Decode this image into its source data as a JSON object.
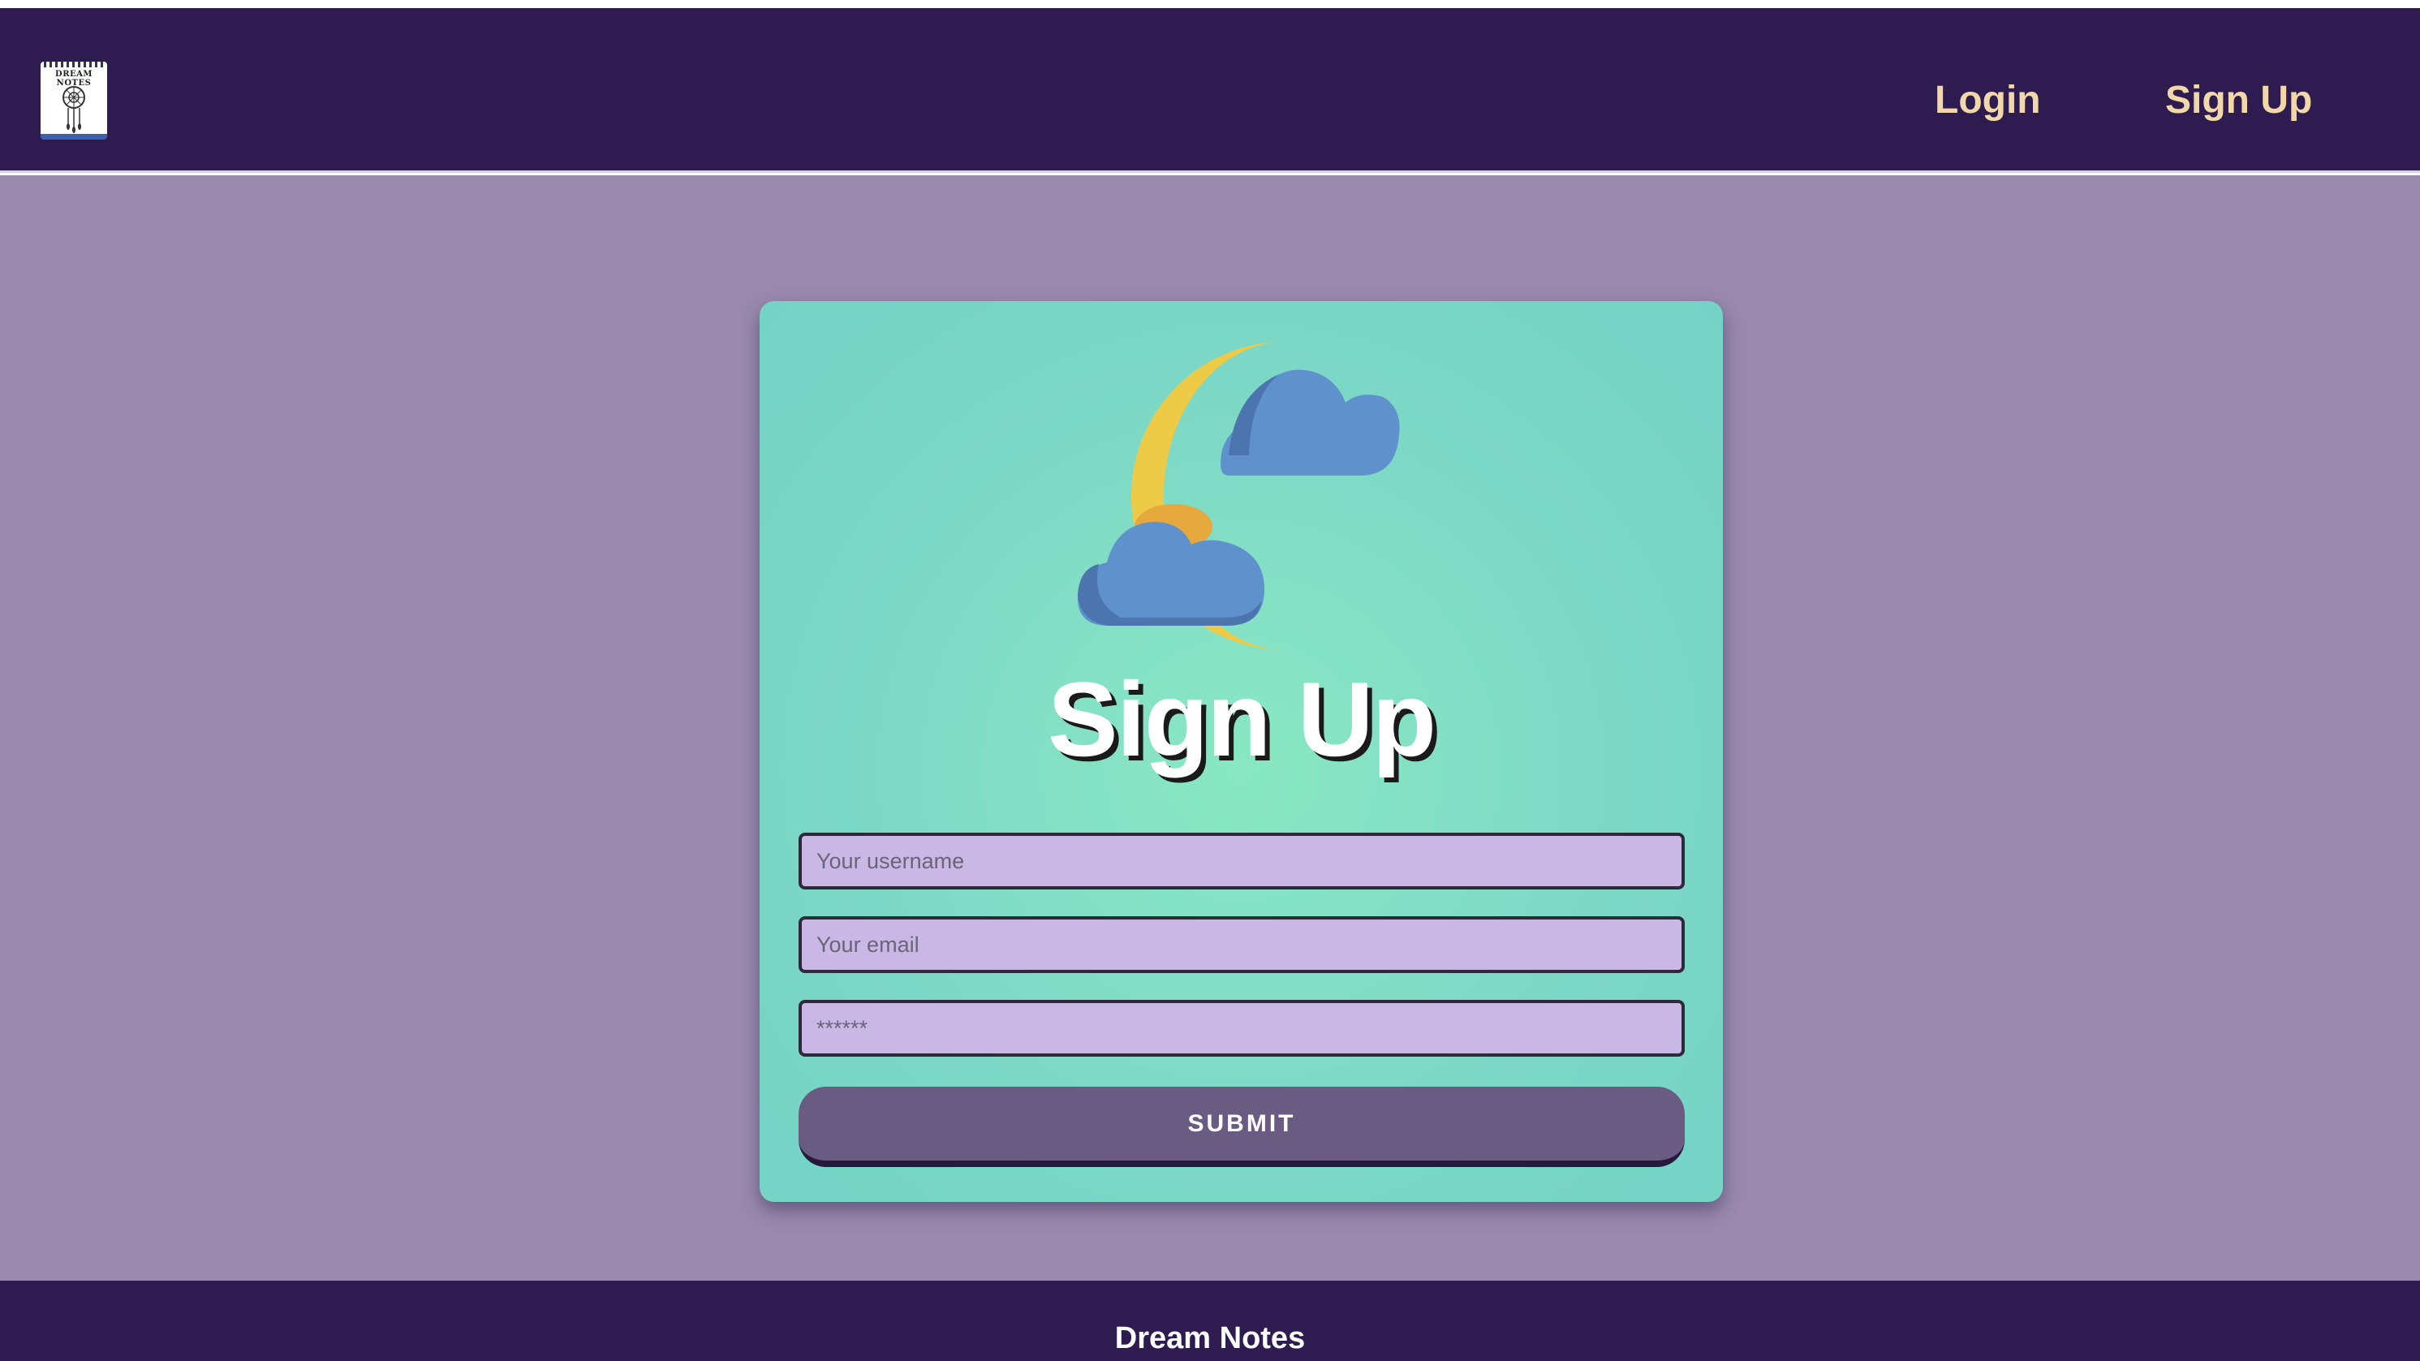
{
  "app": {
    "logo_text": "DREAM NOTES",
    "logo_icon": "dreamcatcher-notebook-icon"
  },
  "nav": {
    "login_label": "Login",
    "signup_label": "Sign Up"
  },
  "form": {
    "title": "Sign Up",
    "illustration_icon": "moon-clouds-icon",
    "username_placeholder": "Your username",
    "email_placeholder": "Your email",
    "password_placeholder": "******",
    "submit_label": "SUBMIT"
  },
  "footer": {
    "title": "Dream Notes"
  },
  "colors": {
    "navbar": "#2e1c51",
    "nav_link": "#f2d7a8",
    "page_background": "#998aad",
    "card": "#7dd8c6",
    "input": "#c9b7e5",
    "button": "#695b81"
  }
}
